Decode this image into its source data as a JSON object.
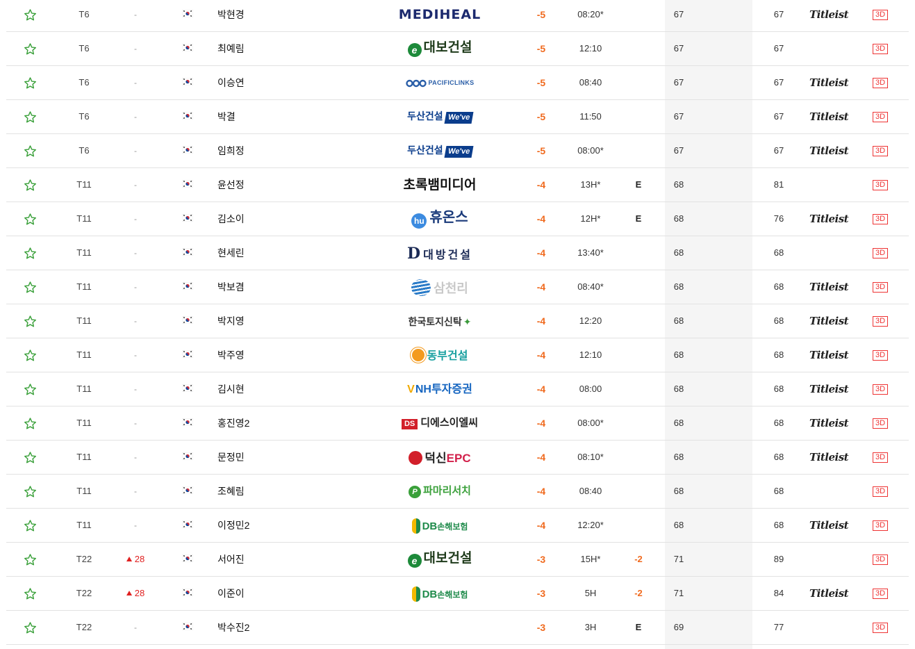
{
  "colors": {
    "accent_orange": "#f06a1e",
    "up_red": "#e02020",
    "star_green": "#3aa03a",
    "threed_red": "#ee3333"
  },
  "rows": [
    {
      "rank": "T6",
      "move": "-",
      "move_up": false,
      "name": "박현경",
      "sponsor": "MEDIHEAL",
      "logo": "mediheal",
      "to_par": "-5",
      "thru": "08:20*",
      "today": "",
      "r1": "67",
      "total": "67",
      "ball": "Titleist",
      "btn": "3D"
    },
    {
      "rank": "T6",
      "move": "-",
      "move_up": false,
      "name": "최예림",
      "sponsor": "대보건설",
      "logo": "dabo",
      "to_par": "-5",
      "thru": "12:10",
      "today": "",
      "r1": "67",
      "total": "67",
      "ball": "",
      "btn": "3D"
    },
    {
      "rank": "T6",
      "move": "-",
      "move_up": false,
      "name": "이승연",
      "sponsor": "PACIFICLINKS",
      "logo": "pacific",
      "to_par": "-5",
      "thru": "08:40",
      "today": "",
      "r1": "67",
      "total": "67",
      "ball": "Titleist",
      "btn": "3D"
    },
    {
      "rank": "T6",
      "move": "-",
      "move_up": false,
      "name": "박결",
      "sponsor": "두산건설",
      "logo": "doosan",
      "to_par": "-5",
      "thru": "11:50",
      "today": "",
      "r1": "67",
      "total": "67",
      "ball": "Titleist",
      "btn": "3D"
    },
    {
      "rank": "T6",
      "move": "-",
      "move_up": false,
      "name": "임희정",
      "sponsor": "두산건설",
      "logo": "doosan",
      "to_par": "-5",
      "thru": "08:00*",
      "today": "",
      "r1": "67",
      "total": "67",
      "ball": "Titleist",
      "btn": "3D"
    },
    {
      "rank": "T11",
      "move": "-",
      "move_up": false,
      "name": "윤선정",
      "sponsor": "초록뱀미디어",
      "logo": "chorok",
      "to_par": "-4",
      "thru": "13H*",
      "today": "E",
      "r1": "68",
      "total": "81",
      "ball": "",
      "btn": "3D"
    },
    {
      "rank": "T11",
      "move": "-",
      "move_up": false,
      "name": "김소이",
      "sponsor": "휴온스",
      "logo": "hyu",
      "to_par": "-4",
      "thru": "12H*",
      "today": "E",
      "r1": "68",
      "total": "76",
      "ball": "Titleist",
      "btn": "3D"
    },
    {
      "rank": "T11",
      "move": "-",
      "move_up": false,
      "name": "현세린",
      "sponsor": "대방건설",
      "logo": "daebang",
      "to_par": "-4",
      "thru": "13:40*",
      "today": "",
      "r1": "68",
      "total": "68",
      "ball": "",
      "btn": "3D"
    },
    {
      "rank": "T11",
      "move": "-",
      "move_up": false,
      "name": "박보겸",
      "sponsor": "삼천리",
      "logo": "samch",
      "to_par": "-4",
      "thru": "08:40*",
      "today": "",
      "r1": "68",
      "total": "68",
      "ball": "Titleist",
      "btn": "3D"
    },
    {
      "rank": "T11",
      "move": "-",
      "move_up": false,
      "name": "박지영",
      "sponsor": "한국토지신탁",
      "logo": "hankuk",
      "to_par": "-4",
      "thru": "12:20",
      "today": "",
      "r1": "68",
      "total": "68",
      "ball": "Titleist",
      "btn": "3D"
    },
    {
      "rank": "T11",
      "move": "-",
      "move_up": false,
      "name": "박주영",
      "sponsor": "동부건설",
      "logo": "dongbu",
      "to_par": "-4",
      "thru": "12:10",
      "today": "",
      "r1": "68",
      "total": "68",
      "ball": "Titleist",
      "btn": "3D"
    },
    {
      "rank": "T11",
      "move": "-",
      "move_up": false,
      "name": "김시현",
      "sponsor": "NH투자증권",
      "logo": "nh",
      "to_par": "-4",
      "thru": "08:00",
      "today": "",
      "r1": "68",
      "total": "68",
      "ball": "Titleist",
      "btn": "3D"
    },
    {
      "rank": "T11",
      "move": "-",
      "move_up": false,
      "name": "홍진영2",
      "sponsor": "디에스이엘씨",
      "logo": "ds",
      "to_par": "-4",
      "thru": "08:00*",
      "today": "",
      "r1": "68",
      "total": "68",
      "ball": "Titleist",
      "btn": "3D"
    },
    {
      "rank": "T11",
      "move": "-",
      "move_up": false,
      "name": "문정민",
      "sponsor": "덕신EPC",
      "logo": "duksin",
      "to_par": "-4",
      "thru": "08:10*",
      "today": "",
      "r1": "68",
      "total": "68",
      "ball": "Titleist",
      "btn": "3D"
    },
    {
      "rank": "T11",
      "move": "-",
      "move_up": false,
      "name": "조혜림",
      "sponsor": "파마리서치",
      "logo": "pamari",
      "to_par": "-4",
      "thru": "08:40",
      "today": "",
      "r1": "68",
      "total": "68",
      "ball": "",
      "btn": "3D"
    },
    {
      "rank": "T11",
      "move": "-",
      "move_up": false,
      "name": "이정민2",
      "sponsor": "DB손해보험",
      "logo": "db",
      "to_par": "-4",
      "thru": "12:20*",
      "today": "",
      "r1": "68",
      "total": "68",
      "ball": "Titleist",
      "btn": "3D"
    },
    {
      "rank": "T22",
      "move": "28",
      "move_up": true,
      "name": "서어진",
      "sponsor": "대보건설",
      "logo": "dabo",
      "to_par": "-3",
      "thru": "15H*",
      "today": "-2",
      "r1": "71",
      "total": "89",
      "ball": "",
      "btn": "3D"
    },
    {
      "rank": "T22",
      "move": "28",
      "move_up": true,
      "name": "이준이",
      "sponsor": "DB손해보험",
      "logo": "db",
      "to_par": "-3",
      "thru": "5H",
      "today": "-2",
      "r1": "71",
      "total": "84",
      "ball": "Titleist",
      "btn": "3D"
    },
    {
      "rank": "T22",
      "move": "-",
      "move_up": false,
      "name": "박수진2",
      "sponsor": "",
      "logo": "",
      "to_par": "-3",
      "thru": "3H",
      "today": "E",
      "r1": "69",
      "total": "77",
      "ball": "",
      "btn": "3D"
    }
  ]
}
